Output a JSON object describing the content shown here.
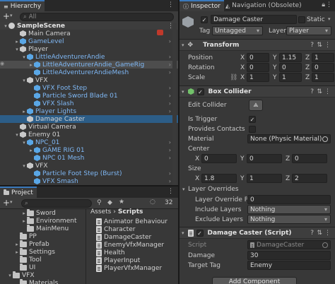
{
  "hierarchy": {
    "tab": "Hierarchy",
    "search_placeholder": "All",
    "scene": "SampleScene",
    "items": [
      {
        "label": "Main Camera",
        "depth": 1,
        "arrow": "",
        "color": "normal"
      },
      {
        "label": "GameLevel",
        "depth": 1,
        "arrow": "▸",
        "color": "blue"
      },
      {
        "label": "Player",
        "depth": 1,
        "arrow": "▾",
        "color": "normal"
      },
      {
        "label": "LittleAdventurerAndie",
        "depth": 2,
        "arrow": "▾",
        "color": "blue"
      },
      {
        "label": "LittleAdventurerAndie_GameRig",
        "depth": 3,
        "arrow": "▸",
        "color": "blue"
      },
      {
        "label": "LittleAdventurerAndieMesh",
        "depth": 3,
        "arrow": "",
        "color": "blue"
      },
      {
        "label": "VFX",
        "depth": 2,
        "arrow": "▾",
        "color": "normal"
      },
      {
        "label": "VFX Foot Step",
        "depth": 3,
        "arrow": "",
        "color": "blue"
      },
      {
        "label": "Particle Sword Blade 01",
        "depth": 3,
        "arrow": "",
        "color": "blue"
      },
      {
        "label": "VFX Slash",
        "depth": 3,
        "arrow": "",
        "color": "blue"
      },
      {
        "label": "Player Lights",
        "depth": 2,
        "arrow": "▸",
        "color": "blue"
      },
      {
        "label": "Damage Caster",
        "depth": 2,
        "arrow": "",
        "color": "normal"
      },
      {
        "label": "Virtual Camera",
        "depth": 1,
        "arrow": "",
        "color": "normal"
      },
      {
        "label": "Enemy 01",
        "depth": 1,
        "arrow": "▾",
        "color": "normal"
      },
      {
        "label": "NPC_01",
        "depth": 2,
        "arrow": "▾",
        "color": "blue"
      },
      {
        "label": "GAME RIG 01",
        "depth": 3,
        "arrow": "▸",
        "color": "blue"
      },
      {
        "label": "NPC 01 Mesh",
        "depth": 3,
        "arrow": "",
        "color": "blue"
      },
      {
        "label": "VFX",
        "depth": 2,
        "arrow": "▾",
        "color": "normal"
      },
      {
        "label": "Particle Foot Step (Burst)",
        "depth": 3,
        "arrow": "",
        "color": "blue"
      },
      {
        "label": "VFX Smash",
        "depth": 3,
        "arrow": "",
        "color": "blue"
      }
    ]
  },
  "project": {
    "tab": "Project",
    "badge": "32",
    "breadcrumb": {
      "root": "Assets",
      "sep": "›",
      "current": "Scripts"
    },
    "folders": [
      {
        "label": "Sword",
        "depth": 3,
        "arrow": "▸"
      },
      {
        "label": "Environment",
        "depth": 3,
        "arrow": "▸"
      },
      {
        "label": "MainMenu",
        "depth": 3,
        "arrow": ""
      },
      {
        "label": "PP",
        "depth": 2,
        "arrow": ""
      },
      {
        "label": "Prefab",
        "depth": 2,
        "arrow": "▸"
      },
      {
        "label": "Settings",
        "depth": 2,
        "arrow": "▸"
      },
      {
        "label": "Tool",
        "depth": 2,
        "arrow": ""
      },
      {
        "label": "UI",
        "depth": 2,
        "arrow": ""
      },
      {
        "label": "VFX",
        "depth": 1,
        "arrow": "▾"
      },
      {
        "label": "Materials",
        "depth": 2,
        "arrow": ""
      }
    ],
    "scripts": [
      "Animator Behaviour",
      "Character",
      "DamageCaster",
      "EnemyVfxManager",
      "Health",
      "PlayerInput",
      "PlayerVfxManager"
    ]
  },
  "inspector": {
    "tabs": [
      "Inspector",
      "Navigation (Obsolete)"
    ],
    "object_name": "Damage Caster",
    "static_label": "Static",
    "tag_label": "Tag",
    "tag_value": "Untagged",
    "layer_label": "Layer",
    "layer_value": "Player",
    "transform": {
      "title": "Transform",
      "rows": [
        {
          "label": "Position",
          "x": "0",
          "y": "1.15",
          "z": "1"
        },
        {
          "label": "Rotation",
          "x": "0",
          "y": "0",
          "z": "0"
        },
        {
          "label": "Scale",
          "x": "1",
          "y": "1",
          "z": "1"
        }
      ]
    },
    "box_collider": {
      "title": "Box Collider",
      "edit_collider": "Edit Collider",
      "is_trigger": "Is Trigger",
      "provides_contacts": "Provides Contacts",
      "material_label": "Material",
      "material_value": "None (Physic Material)",
      "center_label": "Center",
      "center": {
        "x": "0",
        "y": "0",
        "z": "0"
      },
      "size_label": "Size",
      "size": {
        "x": "1.8",
        "y": "1",
        "z": "2"
      },
      "layer_overrides": "Layer Overrides",
      "layer_override_priority": "Layer Override Pri",
      "layer_override_priority_value": "0",
      "include_layers_label": "Include Layers",
      "include_layers_value": "Nothing",
      "exclude_layers_label": "Exclude Layers",
      "exclude_layers_value": "Nothing"
    },
    "damage_caster": {
      "title": "Damage Caster (Script)",
      "script_label": "Script",
      "script_value": "DamageCaster",
      "damage_label": "Damage",
      "damage_value": "30",
      "target_tag_label": "Target Tag",
      "target_tag_value": "Enemy"
    },
    "add_component": "Add Component"
  },
  "axes": {
    "x": "X",
    "y": "Y",
    "z": "Z"
  }
}
